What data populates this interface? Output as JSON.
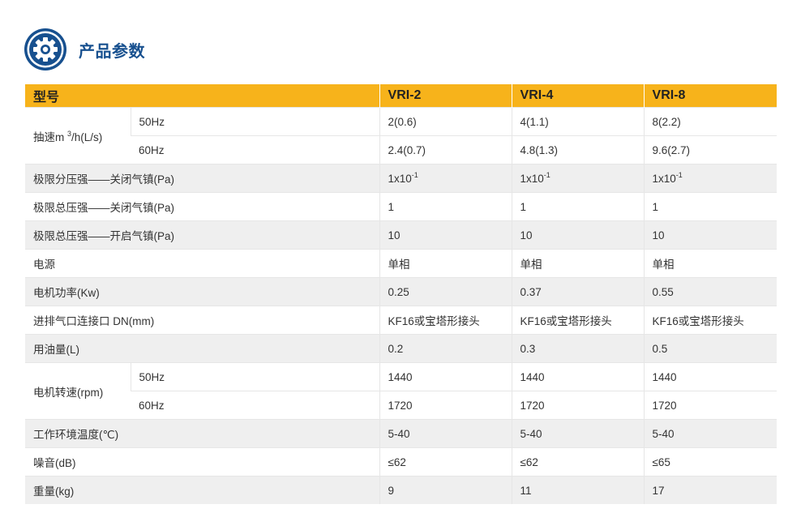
{
  "section": {
    "title": "产品参数",
    "icon": "gear-icon",
    "accent_color": "#17508f"
  },
  "table": {
    "header_color": "#f7b31b",
    "model_label": "型号",
    "models": [
      "VRI-2",
      "VRI-4",
      "VRI-8"
    ],
    "pumping_speed": {
      "label_prefix": "抽速m ",
      "label_sup": "3",
      "label_suffix": "/h(L/s)",
      "rows": [
        {
          "freq": "50Hz",
          "values": [
            "2(0.6)",
            "4(1.1)",
            "8(2.2)"
          ]
        },
        {
          "freq": "60Hz",
          "values": [
            "2.4(0.7)",
            "4.8(1.3)",
            "9.6(2.7)"
          ]
        }
      ]
    },
    "partial_pressure": {
      "label": "极限分压强——关闭气镇(Pa)",
      "base": "1x10",
      "exp": "-1"
    },
    "total_closed": {
      "label": "极限总压强——关闭气镇(Pa)",
      "values": [
        "1",
        "1",
        "1"
      ]
    },
    "total_open": {
      "label": "极限总压强——开启气镇(Pa)",
      "values": [
        "10",
        "10",
        "10"
      ]
    },
    "power_supply": {
      "label": "电源",
      "values": [
        "单相",
        "单相",
        "单相"
      ]
    },
    "motor_power": {
      "label": "电机功率(Kw)",
      "values": [
        "0.25",
        "0.37",
        "0.55"
      ]
    },
    "ports": {
      "label": "进排气口连接口 DN(mm)",
      "values": [
        "KF16或宝塔形接头",
        "KF16或宝塔形接头",
        "KF16或宝塔形接头"
      ]
    },
    "oil": {
      "label": "用油量(L)",
      "values": [
        "0.2",
        "0.3",
        "0.5"
      ]
    },
    "motor_speed": {
      "label": "电机转速(rpm)",
      "rows": [
        {
          "freq": "50Hz",
          "values": [
            "1440",
            "1440",
            "1440"
          ]
        },
        {
          "freq": "60Hz",
          "values": [
            "1720",
            "1720",
            "1720"
          ]
        }
      ]
    },
    "temperature": {
      "label": "工作环境温度(℃)",
      "values": [
        "5-40",
        "5-40",
        "5-40"
      ]
    },
    "noise": {
      "label": "噪音(dB)",
      "values": [
        "≤62",
        "≤62",
        "≤65"
      ]
    },
    "weight": {
      "label": "重量(kg)",
      "values": [
        "9",
        "11",
        "17"
      ]
    }
  }
}
